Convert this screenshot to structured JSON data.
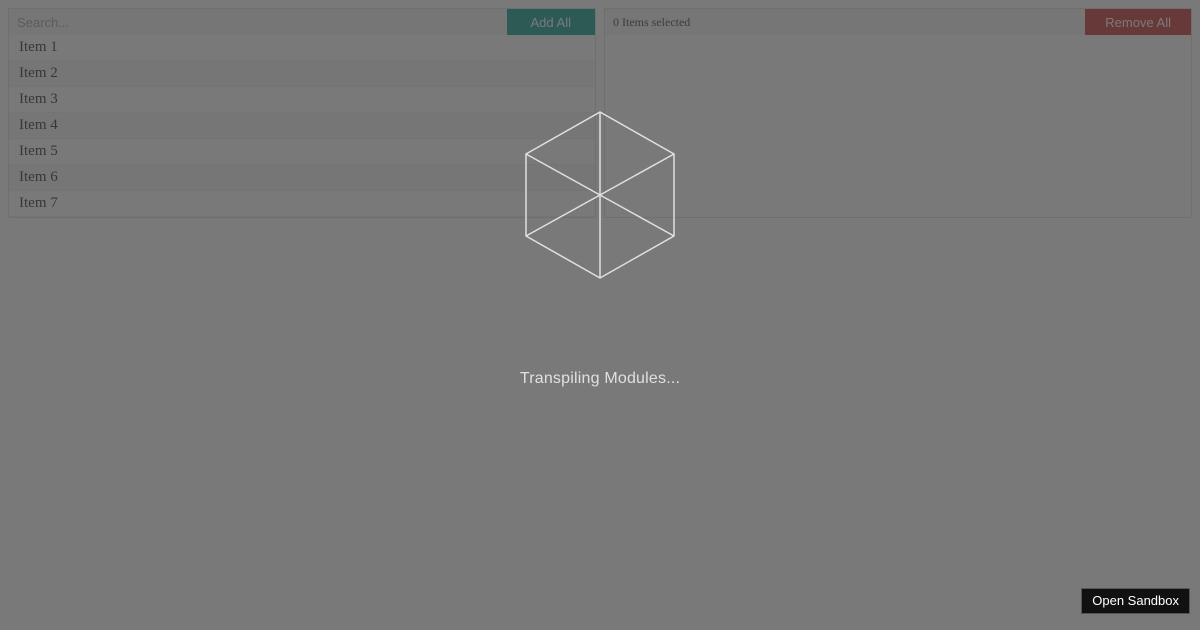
{
  "left": {
    "search_placeholder": "Search...",
    "add_all_label": "Add All",
    "items": [
      {
        "label": "Item 1"
      },
      {
        "label": "Item 2"
      },
      {
        "label": "Item 3"
      },
      {
        "label": "Item 4"
      },
      {
        "label": "Item 5"
      },
      {
        "label": "Item 6"
      },
      {
        "label": "Item 7"
      }
    ]
  },
  "right": {
    "selected_label": "0 Items selected",
    "remove_all_label": "Remove All"
  },
  "overlay": {
    "loading_text": "Transpiling Modules..."
  },
  "sandbox": {
    "open_label": "Open Sandbox"
  }
}
